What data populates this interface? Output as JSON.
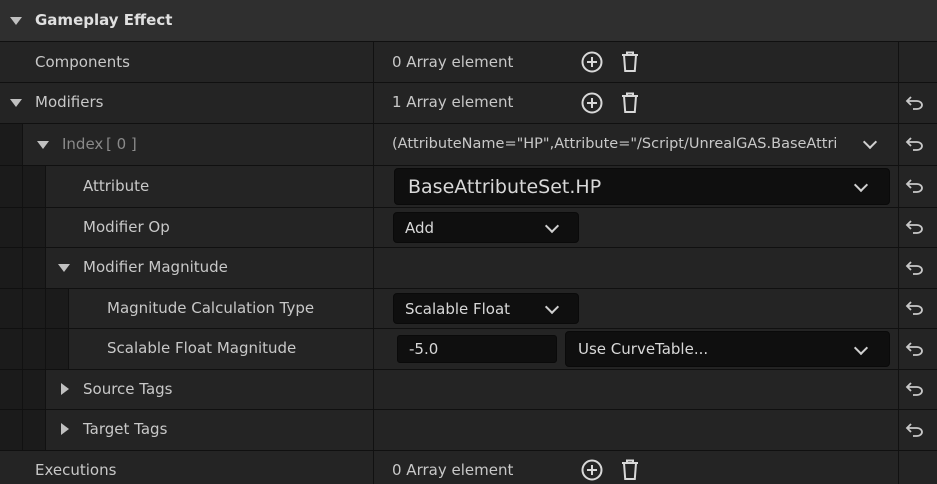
{
  "header": {
    "title": "Gameplay Effect"
  },
  "components": {
    "label": "Components",
    "value": "0 Array element"
  },
  "modifiers": {
    "label": "Modifiers",
    "value": "1 Array element"
  },
  "index": {
    "label": "Index",
    "index_text": "[ 0 ]",
    "value": "(AttributeName=\"HP\",Attribute=\"/Script/UnrealGAS.BaseAttrib"
  },
  "attribute": {
    "label": "Attribute",
    "value": "BaseAttributeSet.HP"
  },
  "modifier_op": {
    "label": "Modifier Op",
    "value": "Add"
  },
  "modifier_magnitude": {
    "label": "Modifier Magnitude"
  },
  "magnitude_calc": {
    "label": "Magnitude Calculation Type",
    "value": "Scalable Float"
  },
  "scalable_float": {
    "label": "Scalable Float Magnitude",
    "value": "-5.0",
    "curve": "Use CurveTable..."
  },
  "source_tags": {
    "label": "Source Tags"
  },
  "target_tags": {
    "label": "Target Tags"
  },
  "executions": {
    "label": "Executions",
    "value": "0 Array element"
  },
  "icons": {
    "add": "plus-circle-icon",
    "delete": "trash-icon",
    "reset": "reset-to-default-icon",
    "expand": "triangle-down-icon",
    "collapse": "triangle-right-icon"
  },
  "colors": {
    "background": "#151515",
    "row": "#242424",
    "input": "#0f0f0f",
    "text": "#c8c8c8"
  }
}
